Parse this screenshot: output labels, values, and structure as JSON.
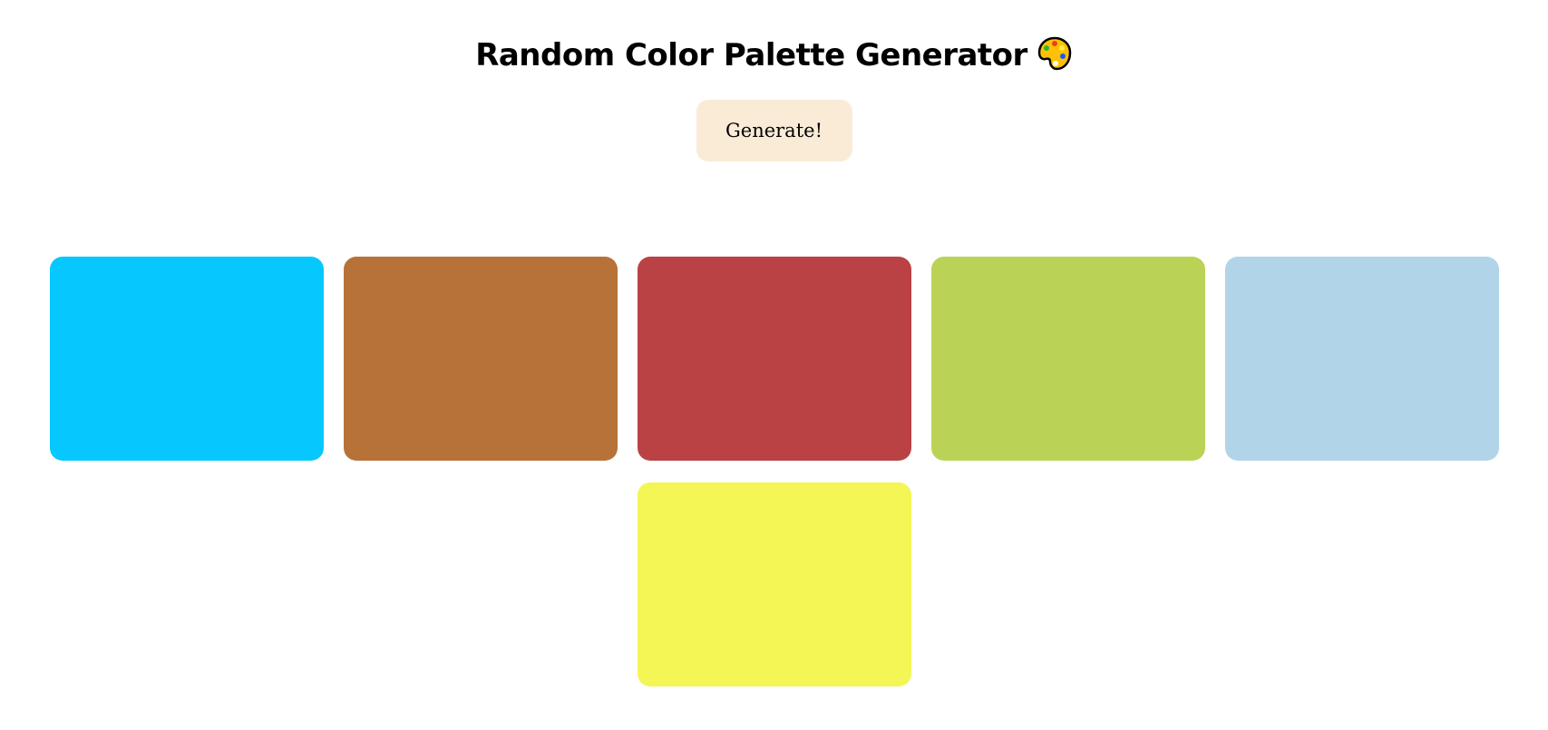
{
  "header": {
    "title": "Random Color Palette Generator",
    "icon": "artist-palette-icon"
  },
  "generate_button": {
    "label": "Generate!",
    "color": "#FAEBD7"
  },
  "swatches": [
    {
      "color": "#06C8FE"
    },
    {
      "color": "#B77238"
    },
    {
      "color": "#BA4245"
    },
    {
      "color": "#BAD357"
    },
    {
      "color": "#B1D4E8"
    },
    {
      "color": "#F3F655"
    }
  ]
}
